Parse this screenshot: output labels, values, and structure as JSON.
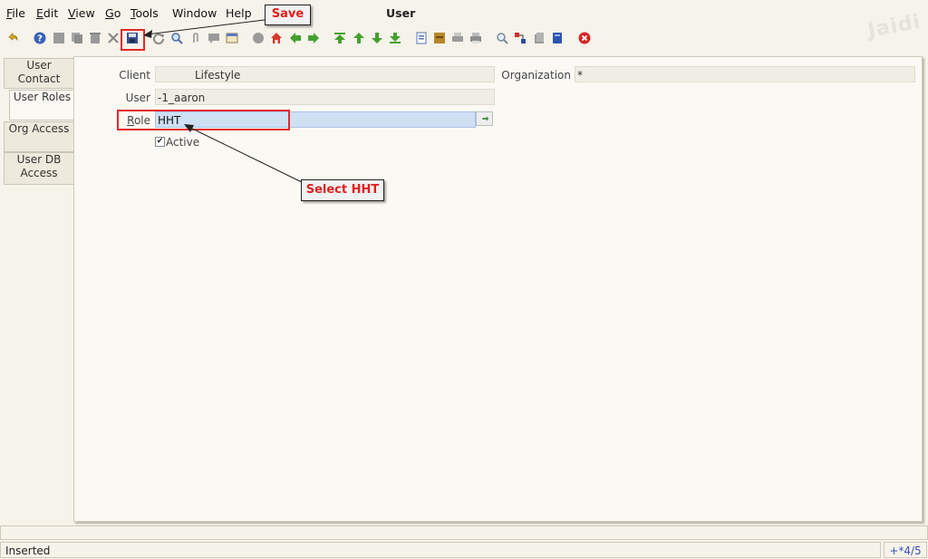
{
  "menu": [
    {
      "name": "File",
      "mnemonic": "F",
      "rest": "ile"
    },
    {
      "name": "Edit",
      "mnemonic": "E",
      "rest": "dit"
    },
    {
      "name": "View",
      "mnemonic": "V",
      "rest": "iew"
    },
    {
      "name": "Go",
      "mnemonic": "G",
      "rest": "o"
    },
    {
      "name": "Tools",
      "mnemonic": "T",
      "rest": "ools"
    },
    {
      "name": "Window",
      "mnemonic": "",
      "rest": "Window"
    },
    {
      "name": "Help",
      "mnemonic": "",
      "rest": "Help"
    }
  ],
  "window_title": "User",
  "brand_text": "Jaidi",
  "tabs": [
    "User Contact",
    "User Roles",
    "Org Access",
    "User DB Access"
  ],
  "form": {
    "client_label": "Client",
    "client_value": "Lifestyle",
    "organization_label": "Organization",
    "organization_value": "*",
    "user_label": "User",
    "user_value": "-1_aaron",
    "role_label": "Role",
    "role_mnemonic": "R",
    "role_rest": "ole",
    "role_value": "HHT",
    "active_label": "Active",
    "active_checked": "✔"
  },
  "annotations": {
    "save": "Save",
    "select_hht": "Select HHT"
  },
  "status": {
    "message": "Inserted",
    "record": "+*4/5"
  },
  "colors": {
    "accent_red": "#e02020",
    "role_highlight": "#cfe0f5",
    "record_text": "#3b4fbd"
  }
}
